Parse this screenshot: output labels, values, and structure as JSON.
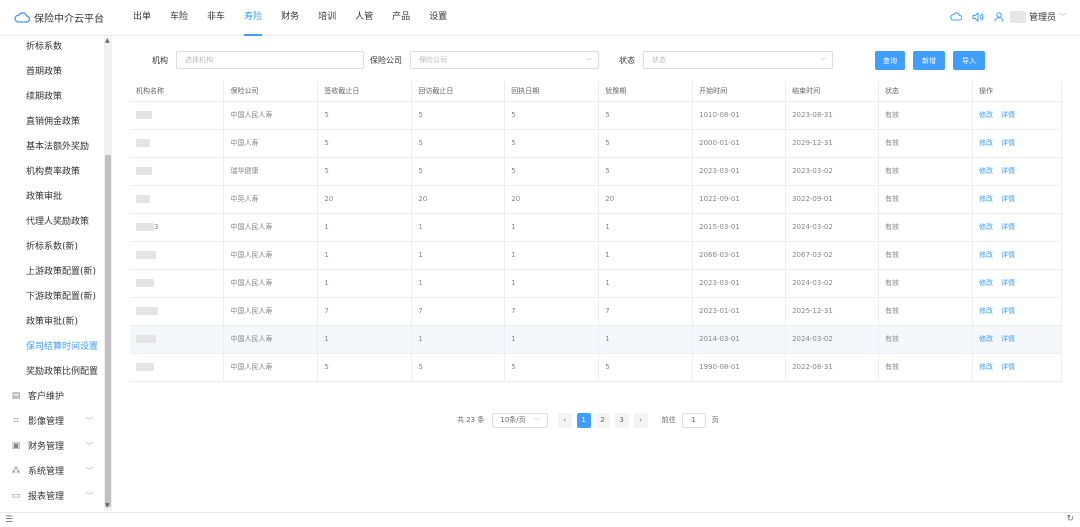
{
  "app": {
    "title": "保险中介云平台"
  },
  "nav": [
    "出单",
    "车险",
    "非车",
    "寿险",
    "财务",
    "培训",
    "人管",
    "产品",
    "设置"
  ],
  "user": {
    "name": "管理员"
  },
  "sidebar": {
    "items": [
      "折标系数",
      "首期政策",
      "续期政策",
      "直销佣金政策",
      "基本法额外奖励",
      "机构费率政策",
      "政策审批",
      "代理人奖励政策",
      "折标系数(新)",
      "上游政策配置(新)",
      "下游政策配置(新)",
      "政策审批(新)",
      "保司结算时间设置",
      "奖励政策比例配置"
    ],
    "groups": [
      "客户维护",
      "影像管理",
      "财务管理",
      "系统管理",
      "报表管理"
    ]
  },
  "filters": {
    "org_label": "机构",
    "org_placeholder": "选择机构",
    "ins_label": "保险公司",
    "ins_placeholder": "保险公司",
    "status_label": "状态",
    "status_placeholder": "状态"
  },
  "buttons": {
    "query": "查询",
    "add": "新增",
    "import": "导入"
  },
  "table": {
    "columns": [
      "机构名称",
      "保险公司",
      "签收截止日",
      "回访截止日",
      "回执日期",
      "犹豫期",
      "开始时间",
      "结束时间",
      "状态",
      "操作"
    ],
    "rows": [
      {
        "org": "",
        "ins": "中国人民人寿",
        "sign": "5",
        "visit": "5",
        "receipt": "5",
        "hes": "5",
        "start": "1010-08-01",
        "end": "2023-08-31",
        "status": "有效"
      },
      {
        "org": "",
        "ins": "中国人寿",
        "sign": "5",
        "visit": "5",
        "receipt": "5",
        "hes": "5",
        "start": "2000-01-01",
        "end": "2029-12-31",
        "status": "有效"
      },
      {
        "org": "",
        "ins": "瑞华健康",
        "sign": "5",
        "visit": "5",
        "receipt": "5",
        "hes": "5",
        "start": "2023-03-01",
        "end": "2023-03-02",
        "status": "有效"
      },
      {
        "org": "",
        "ins": "中英人寿",
        "sign": "20",
        "visit": "20",
        "receipt": "20",
        "hes": "20",
        "start": "1022-09-01",
        "end": "3022-09-01",
        "status": "有效"
      },
      {
        "org": "3",
        "ins": "中国人民人寿",
        "sign": "1",
        "visit": "1",
        "receipt": "1",
        "hes": "1",
        "start": "2015-03-01",
        "end": "2024-03-02",
        "status": "有效"
      },
      {
        "org": "",
        "ins": "中国人民人寿",
        "sign": "1",
        "visit": "1",
        "receipt": "1",
        "hes": "1",
        "start": "2066-03-01",
        "end": "2067-03-02",
        "status": "有效"
      },
      {
        "org": "",
        "ins": "中国人民人寿",
        "sign": "1",
        "visit": "1",
        "receipt": "1",
        "hes": "1",
        "start": "2023-03-01",
        "end": "2024-03-02",
        "status": "有效"
      },
      {
        "org": "",
        "ins": "中国人民人寿",
        "sign": "7",
        "visit": "7",
        "receipt": "7",
        "hes": "7",
        "start": "2023-01-01",
        "end": "2025-12-31",
        "status": "有效"
      },
      {
        "org": "",
        "ins": "中国人民人寿",
        "sign": "1",
        "visit": "1",
        "receipt": "1",
        "hes": "1",
        "start": "2014-03-01",
        "end": "2024-03-02",
        "status": "有效"
      },
      {
        "org": "",
        "ins": "中国人民人寿",
        "sign": "5",
        "visit": "5",
        "receipt": "5",
        "hes": "5",
        "start": "1990-08-01",
        "end": "2022-08-31",
        "status": "有效"
      }
    ],
    "op_edit": "修改",
    "op_detail": "详情"
  },
  "pager": {
    "total": "共 23 条",
    "size": "10条/页",
    "pages": [
      "1",
      "2",
      "3"
    ],
    "goto": "前往",
    "page_input": "1",
    "page_unit": "页"
  }
}
